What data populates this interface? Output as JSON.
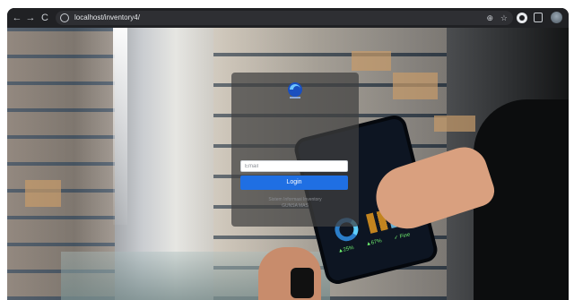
{
  "browser": {
    "url": "localhost/inventory4/",
    "back_icon": "←",
    "forward_icon": "→",
    "reload_icon": "C",
    "zoom_icon": "⊕",
    "star_icon": "☆"
  },
  "login": {
    "email_placeholder": "Email",
    "password_placeholder": "Password",
    "button_label": "Login",
    "tagline_line1": "Sistem Informasi Inventory",
    "tagline_line2": "GUNSA MAS"
  },
  "background": {
    "tablet_stats": [
      "▲25%",
      "▲67%",
      "✓ Fine"
    ]
  },
  "colors": {
    "accent": "#1f6fe3",
    "chrome_bg": "#202124"
  }
}
